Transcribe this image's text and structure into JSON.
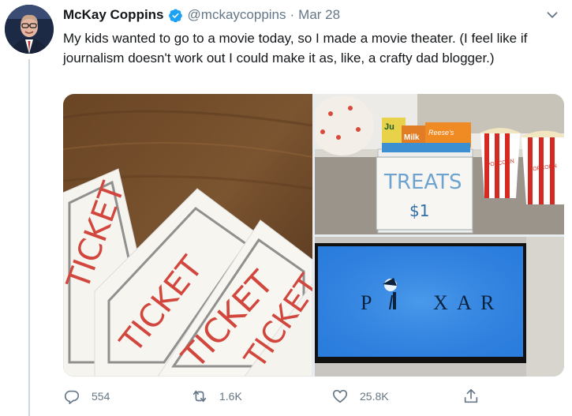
{
  "tweet": {
    "author_name": "McKay Coppins",
    "handle": "@mckaycoppins",
    "separator": "·",
    "date": "Mar 28",
    "text": "My kids wanted to go to a movie today, so I made a movie theater. (I feel like if journalism doesn't work out I could make it as, like, a crafty dad blogger.)"
  },
  "media": {
    "tickets": {
      "word": "TICKET"
    },
    "treats": {
      "sign_title": "TREATS",
      "sign_price": "$1",
      "box_label": "POPCORN",
      "candy_1": "Reese's",
      "candy_2": "Milk",
      "candy_3": "Ju"
    },
    "pixar": {
      "logo": "PIXAR",
      "letters": [
        "P",
        "X",
        "A",
        "R"
      ]
    }
  },
  "actions": {
    "replies": "554",
    "retweets": "1.6K",
    "likes": "25.8K"
  },
  "colors": {
    "accent": "#1da1f2",
    "secondary_text": "#657786",
    "thread_line": "#ccd6dd"
  },
  "icons": [
    "verified-badge-icon",
    "chevron-down-icon",
    "reply-icon",
    "retweet-icon",
    "like-icon",
    "share-icon"
  ]
}
